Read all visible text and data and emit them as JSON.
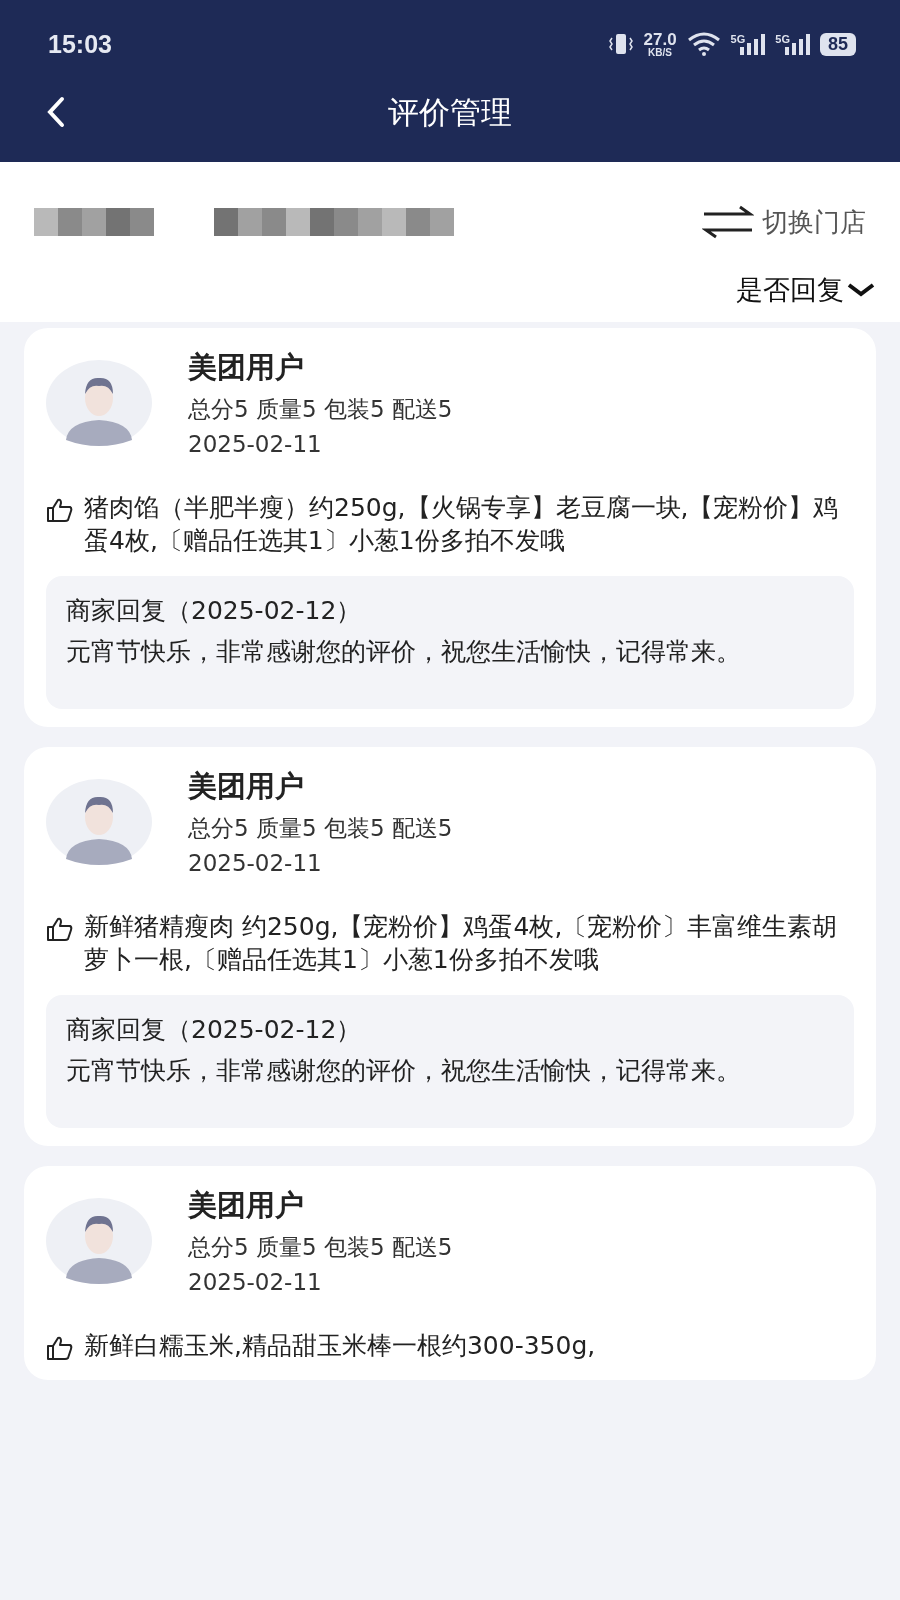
{
  "status_bar": {
    "time": "15:03",
    "speed": "27.0",
    "speed_unit": "KB/S",
    "sim_1": "5G",
    "sim_2": "5G",
    "battery": "85"
  },
  "header": {
    "title": "评价管理"
  },
  "store": {
    "switch_label": "切换门店"
  },
  "filter": {
    "label": "是否回复"
  },
  "reviews": [
    {
      "user": "美团用户",
      "scores": "总分5 质量5 包装5 配送5",
      "date": "2025-02-11",
      "comment": "猪肉馅（半肥半瘦）约250g,【火锅专享】老豆腐一块,【宠粉价】鸡蛋4枚,〔赠品任选其1〕小葱1份多拍不发哦",
      "reply_title": "商家回复（2025-02-12）",
      "reply": "元宵节快乐，非常感谢您的评价，祝您生活愉快，记得常来。"
    },
    {
      "user": "美团用户",
      "scores": "总分5 质量5 包装5 配送5",
      "date": "2025-02-11",
      "comment": "新鲜猪精瘦肉 约250g,【宠粉价】鸡蛋4枚,〔宠粉价〕丰富维生素胡萝卜一根,〔赠品任选其1〕小葱1份多拍不发哦",
      "reply_title": "商家回复（2025-02-12）",
      "reply": "元宵节快乐，非常感谢您的评价，祝您生活愉快，记得常来。"
    },
    {
      "user": "美团用户",
      "scores": "总分5 质量5 包装5 配送5",
      "date": "2025-02-11",
      "comment": "新鲜白糯玉米,精品甜玉米棒一根约300-350g,"
    }
  ]
}
